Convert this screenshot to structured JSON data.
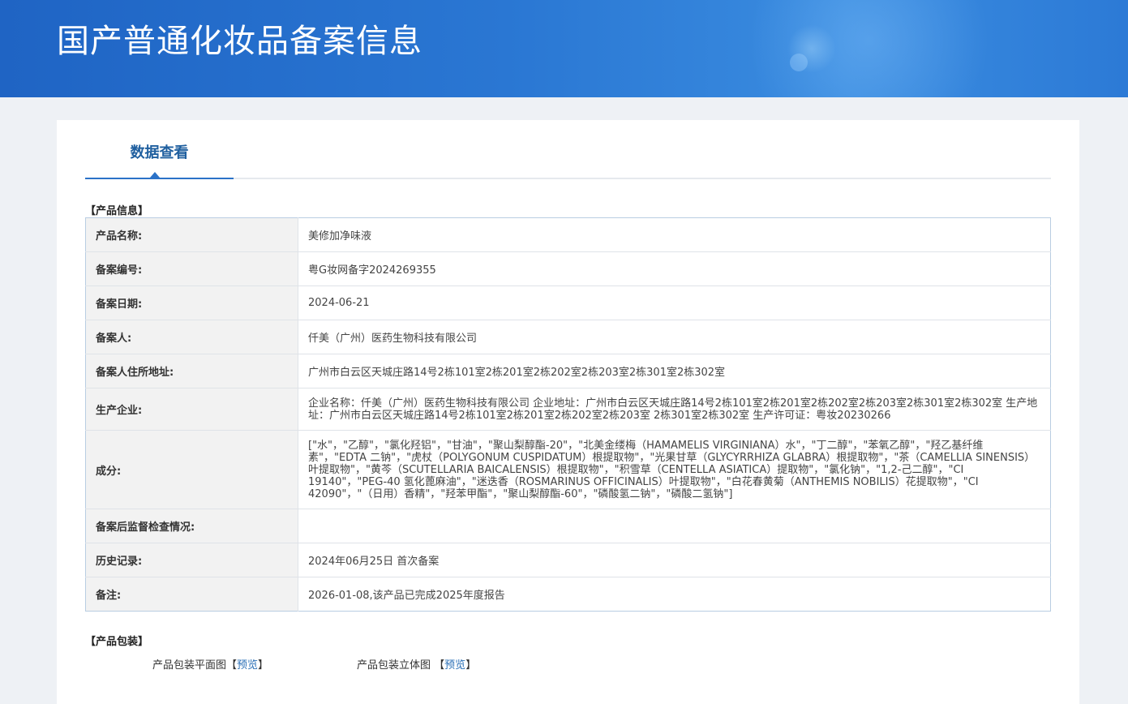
{
  "header": {
    "title": "国产普通化妆品备案信息"
  },
  "tab": {
    "label": "数据查看"
  },
  "product_info": {
    "heading": "【产品信息】",
    "rows": [
      {
        "label": "产品名称:",
        "value": "美修加净味液"
      },
      {
        "label": "备案编号:",
        "value": "粤G妆网备字2024269355"
      },
      {
        "label": "备案日期:",
        "value": "2024-06-21"
      },
      {
        "label": "备案人:",
        "value": "仟美（广州）医药生物科技有限公司"
      },
      {
        "label": "备案人住所地址:",
        "value": "广州市白云区天城庄路14号2栋101室2栋201室2栋202室2栋203室2栋301室2栋302室"
      },
      {
        "label": "生产企业:",
        "value": "企业名称：仟美（广州）医药生物科技有限公司 企业地址：广州市白云区天城庄路14号2栋101室2栋201室2栋202室2栋203室2栋301室2栋302室 生产地址：广州市白云区天城庄路14号2栋101室2栋201室2栋202室2栋203室 2栋301室2栋302室 生产许可证：粤妆20230266"
      },
      {
        "label": "成分:",
        "value": "[\"水\"，\"乙醇\"，\"氯化羟铝\"，\"甘油\"，\"聚山梨醇酯-20\"，\"北美金缕梅（HAMAMELIS VIRGINIANA）水\"，\"丁二醇\"，\"苯氧乙醇\"，\"羟乙基纤维素\"，\"EDTA 二钠\"，\"虎杖（POLYGONUM CUSPIDATUM）根提取物\"，\"光果甘草（GLYCYRRHIZA GLABRA）根提取物\"，\"茶（CAMELLIA SINENSIS）叶提取物\"，\"黄芩（SCUTELLARIA BAICALENSIS）根提取物\"，\"积雪草（CENTELLA ASIATICA）提取物\"，\"氯化钠\"，\"1,2-己二醇\"，\"CI 19140\"，\"PEG-40 氢化蓖麻油\"，\"迷迭香（ROSMARINUS OFFICINALIS）叶提取物\"，\"白花春黄菊（ANTHEMIS NOBILIS）花提取物\"，\"CI 42090\"，\"（日用）香精\"，\"羟苯甲酯\"，\"聚山梨醇酯-60\"，\"磷酸氢二钠\"，\"磷酸二氢钠\"]"
      },
      {
        "label": "备案后监督检查情况:",
        "value": ""
      },
      {
        "label": "历史记录:",
        "value": "2024年06月25日 首次备案"
      },
      {
        "label": "备注:",
        "value": "2026-01-08,该产品已完成2025年度报告"
      }
    ]
  },
  "packaging": {
    "heading": "【产品包装】",
    "flat_label": "产品包装平面图",
    "stereo_label": "产品包装立体图",
    "bracket_open": "【",
    "bracket_close": "】",
    "preview_label": "预览"
  }
}
